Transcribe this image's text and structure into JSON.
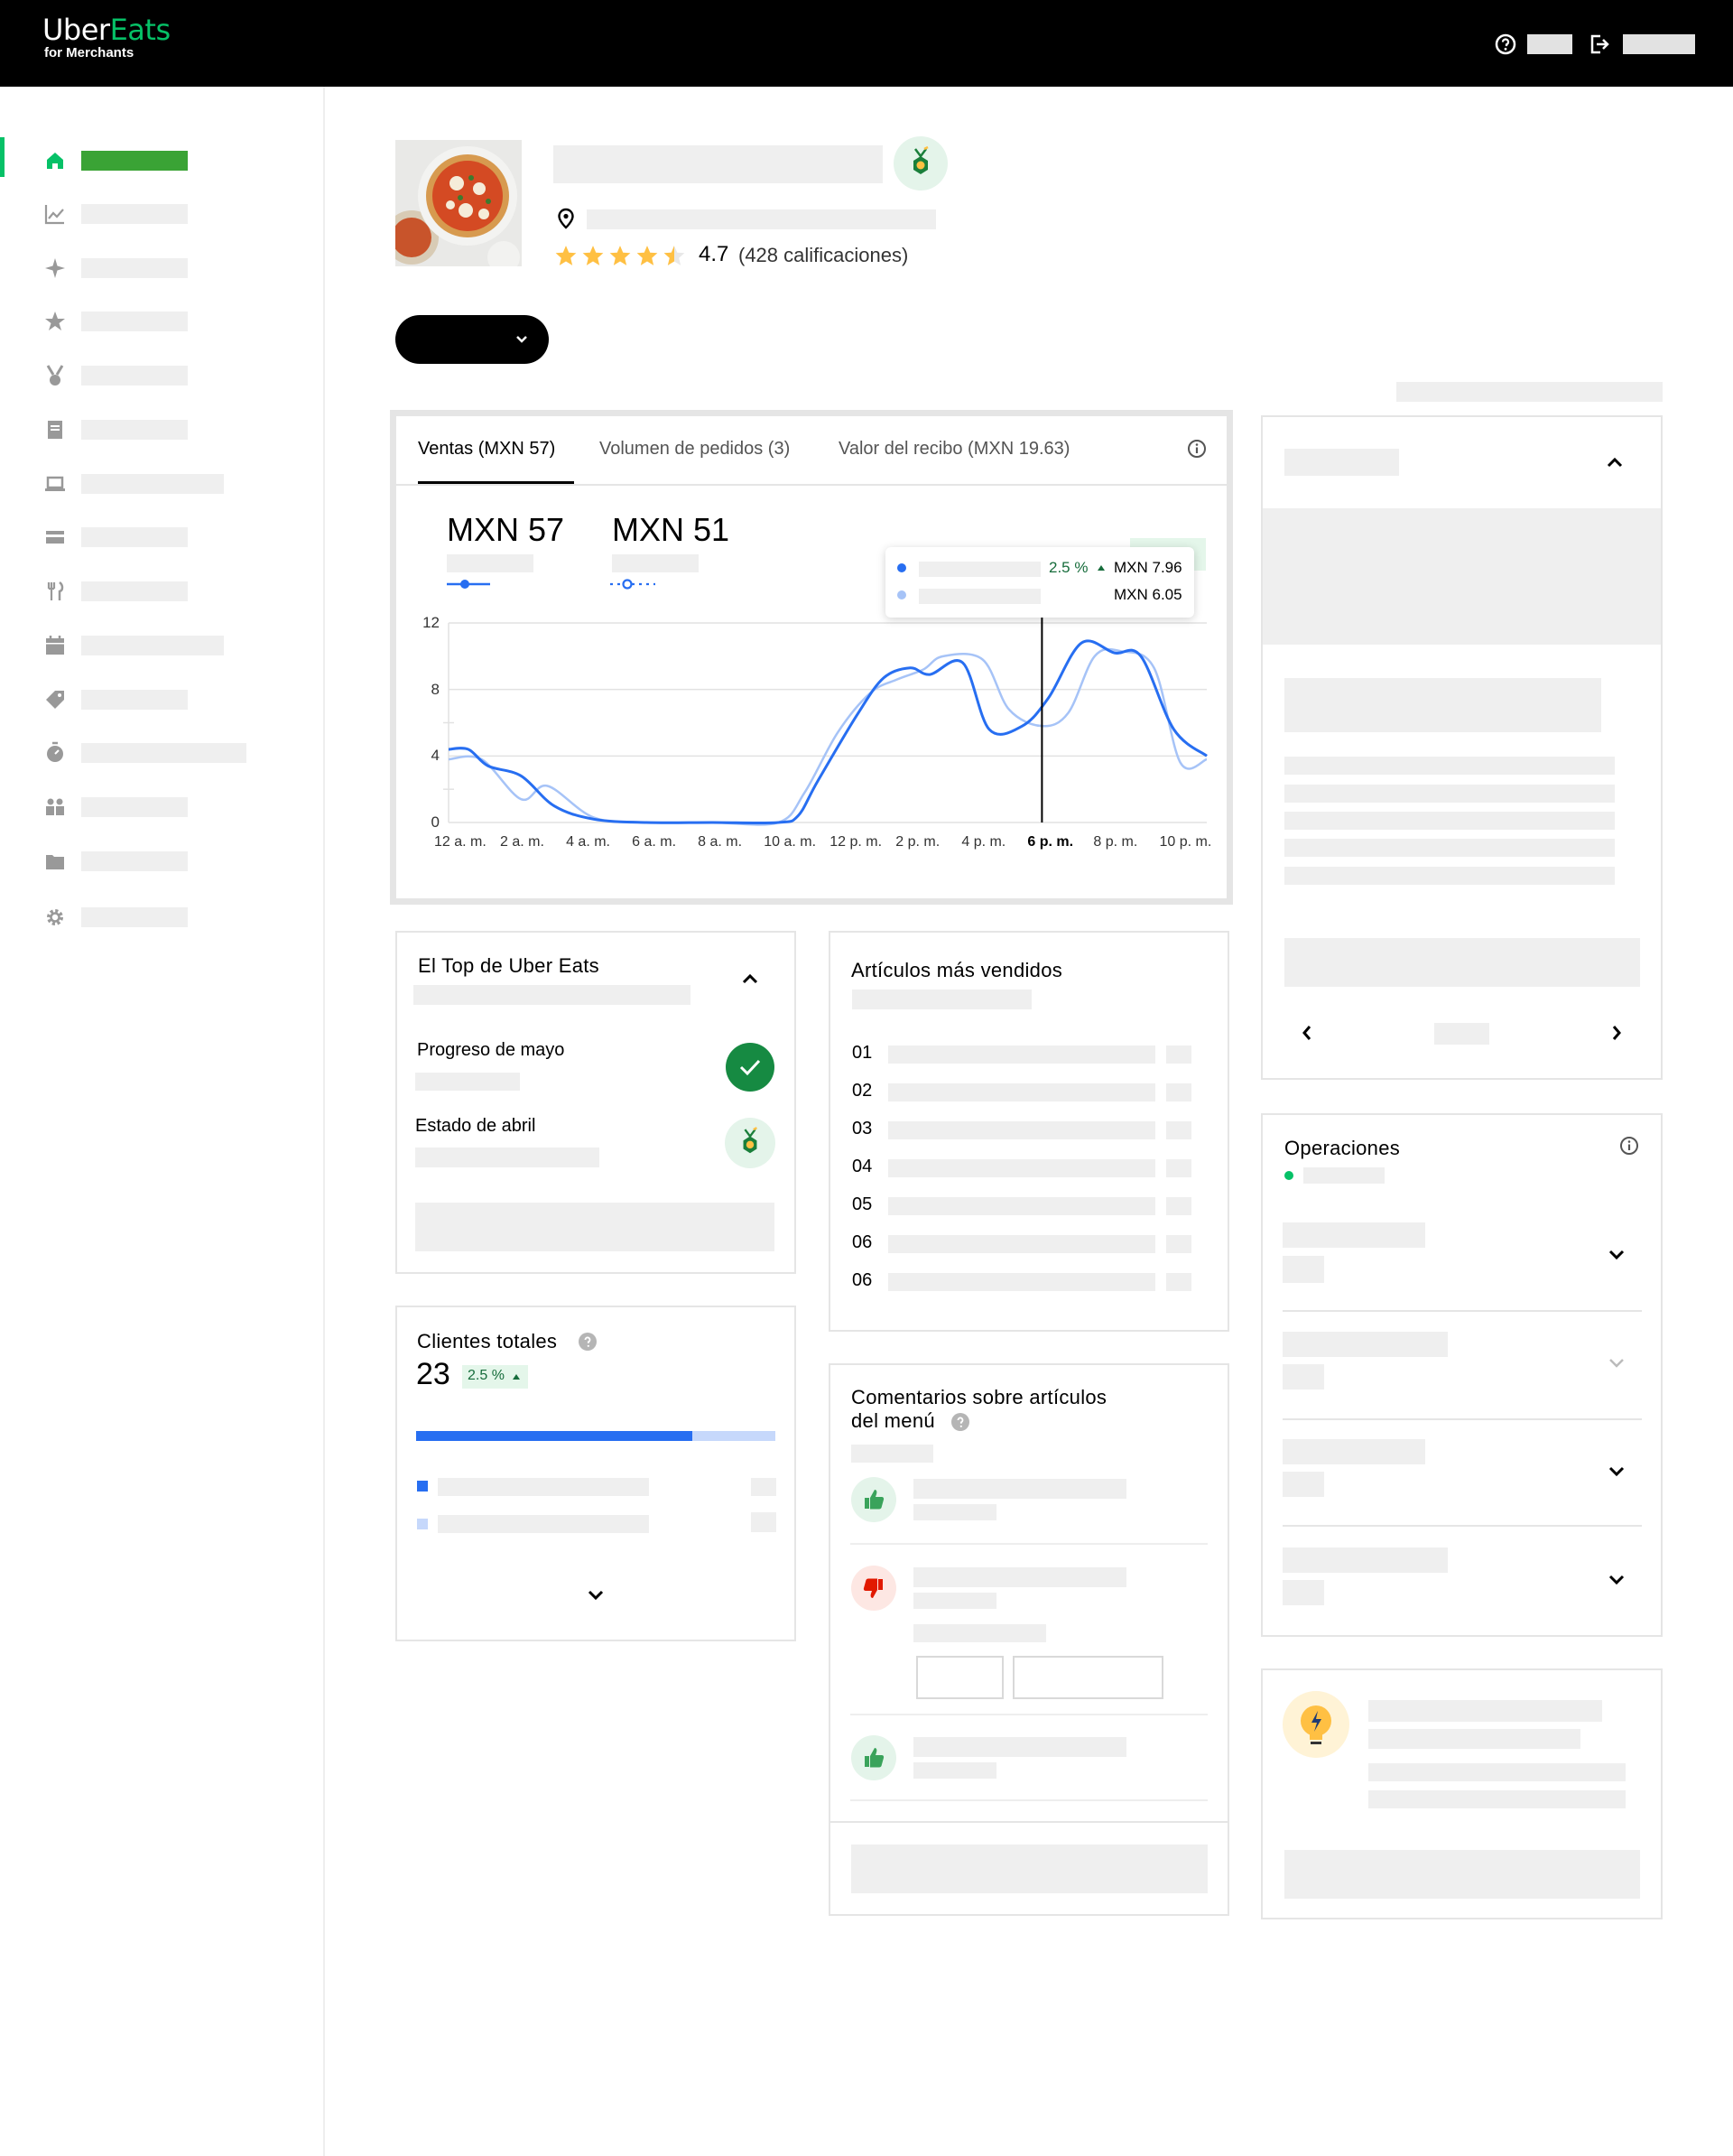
{
  "header": {
    "logo_primary": "Uber",
    "logo_accent": "Eats",
    "logo_sub": "for Merchants"
  },
  "store": {
    "rating": "4.7",
    "rating_count": "(428 calificaciones)",
    "stars": 4.5
  },
  "sales_card": {
    "tabs": [
      "Ventas (MXN 57)",
      "Volumen de pedidos (3)",
      "Valor del recibo (MXN 19.63)"
    ],
    "metric_primary": "MXN 57",
    "metric_secondary": "MXN 51",
    "tooltip": {
      "change": "2.5 %",
      "value_primary": "MXN 7.96",
      "value_secondary": "MXN 6.05"
    }
  },
  "chart_data": {
    "type": "line",
    "x": [
      "12 a. m.",
      "2 a. m.",
      "4 a. m.",
      "6 a. m.",
      "8 a. m.",
      "10 a. m.",
      "12 p. m.",
      "2 p. m.",
      "4 p. m.",
      "6 p. m.",
      "8 p. m.",
      "10 p. m."
    ],
    "ylim": [
      0,
      12
    ],
    "yticks": [
      "12",
      "8",
      "4",
      "0"
    ],
    "highlight_x": "6 p. m.",
    "series": [
      {
        "color": "#276ef1",
        "points": [
          [
            0,
            4.4
          ],
          [
            0.6,
            4.4
          ],
          [
            1.2,
            3.4
          ],
          [
            2.2,
            2.8
          ],
          [
            3.2,
            1.0
          ],
          [
            4.4,
            0.2
          ],
          [
            6,
            0
          ],
          [
            8,
            0
          ],
          [
            10,
            0
          ],
          [
            10.6,
            0.4
          ],
          [
            11.2,
            2.5
          ],
          [
            12.4,
            6.5
          ],
          [
            13.2,
            8.7
          ],
          [
            14,
            9.3
          ],
          [
            14.6,
            8.9
          ],
          [
            15.6,
            9.6
          ],
          [
            16.4,
            5.6
          ],
          [
            17.4,
            5.8
          ],
          [
            18.2,
            7.5
          ],
          [
            19.2,
            10.8
          ],
          [
            20.2,
            10.2
          ],
          [
            21,
            10.0
          ],
          [
            22,
            5.6
          ],
          [
            23,
            4.0
          ]
        ]
      },
      {
        "color": "#a6c3f7",
        "points": [
          [
            0,
            3.8
          ],
          [
            1,
            3.8
          ],
          [
            2.2,
            1.4
          ],
          [
            3,
            2.2
          ],
          [
            4.4,
            0.3
          ],
          [
            6,
            0
          ],
          [
            8,
            0
          ],
          [
            10,
            0
          ],
          [
            10.8,
            1.8
          ],
          [
            11.8,
            5.4
          ],
          [
            12.8,
            7.8
          ],
          [
            13.6,
            8.6
          ],
          [
            14.4,
            9.2
          ],
          [
            15,
            10.0
          ],
          [
            16.2,
            9.8
          ],
          [
            17,
            6.8
          ],
          [
            18,
            5.8
          ],
          [
            18.8,
            6.6
          ],
          [
            19.6,
            10.0
          ],
          [
            20.4,
            10.3
          ],
          [
            21.4,
            9.3
          ],
          [
            22.2,
            3.6
          ],
          [
            23,
            3.8
          ]
        ]
      }
    ]
  },
  "top_card": {
    "title": "El Top de Uber Eats",
    "progress_label": "Progreso de mayo",
    "status_label": "Estado de abril"
  },
  "best_sellers": {
    "title": "Artículos más vendidos",
    "ranks": [
      "01",
      "02",
      "03",
      "04",
      "05",
      "06",
      "06"
    ]
  },
  "customers": {
    "title": "Clientes totales",
    "count": "23",
    "change": "2.5 %",
    "bar_fraction": 0.77
  },
  "comments": {
    "title_line1": "Comentarios sobre artículos",
    "title_line2": "del menú"
  },
  "operations": {
    "title": "Operaciones"
  },
  "colors": {
    "brand_green": "#06c167",
    "primary_blue": "#276ef1",
    "light_blue": "#a6c3f7",
    "star": "#ffc043",
    "negative": "#e11900"
  }
}
